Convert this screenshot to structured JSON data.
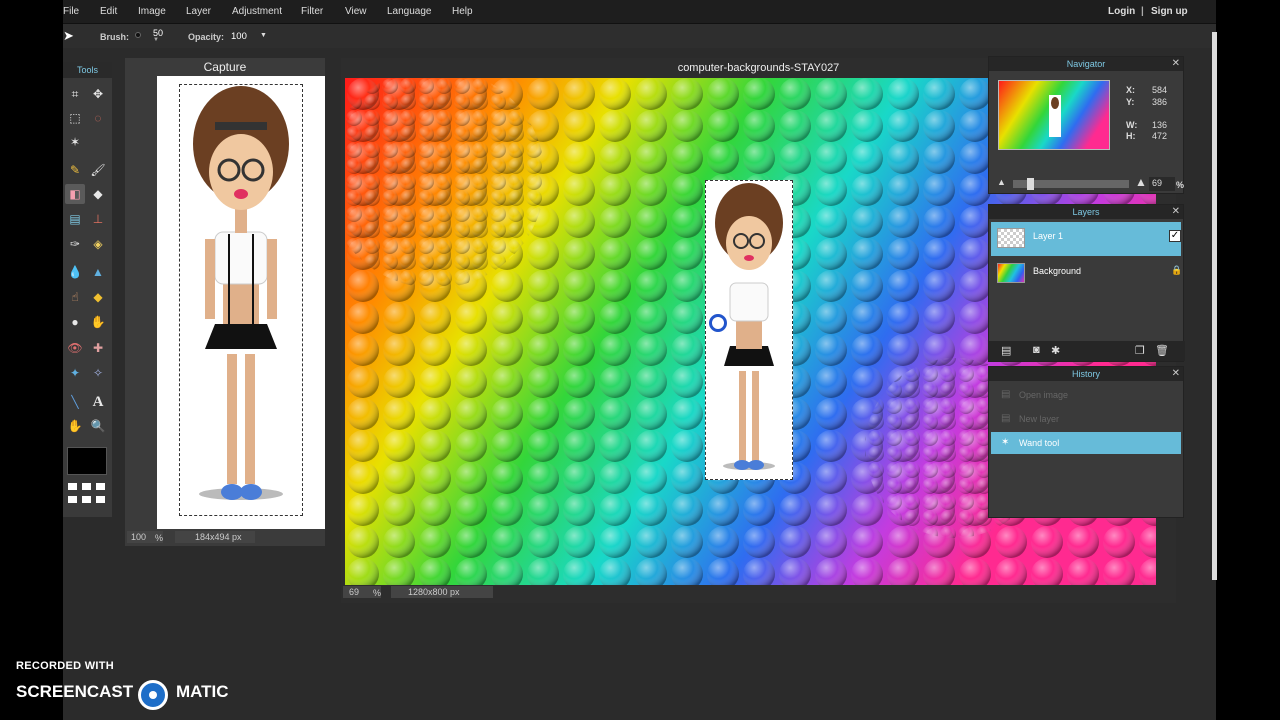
{
  "menu": {
    "items": [
      "File",
      "Edit",
      "Image",
      "Layer",
      "Adjustment",
      "Filter",
      "View",
      "Language",
      "Help"
    ],
    "login": "Login",
    "separator": "|",
    "signup": "Sign up"
  },
  "options": {
    "brush_label": "Brush:",
    "brush_size": "50",
    "opacity_label": "Opacity:",
    "opacity_value": "100"
  },
  "tools": {
    "title": "Tools",
    "foreground_color": "#000000"
  },
  "capture": {
    "title": "Capture",
    "zoom": "100",
    "zoom_unit": "%",
    "dimensions": "184x494 px"
  },
  "document": {
    "title": "computer-backgrounds-STAY027",
    "zoom": "69",
    "zoom_unit": "%",
    "dimensions": "1280x800 px"
  },
  "navigator": {
    "title": "Navigator",
    "x_label": "X:",
    "x_value": "584",
    "y_label": "Y:",
    "y_value": "386",
    "w_label": "W:",
    "w_value": "136",
    "h_label": "H:",
    "h_value": "472",
    "zoom_value": "69",
    "zoom_unit": "%"
  },
  "layers": {
    "title": "Layers",
    "items": [
      {
        "label": "Layer 1"
      },
      {
        "label": "Background"
      }
    ]
  },
  "history": {
    "title": "History",
    "items": [
      {
        "label": "Open image"
      },
      {
        "label": "New layer"
      },
      {
        "label": "Wand tool"
      }
    ]
  },
  "watermark": {
    "line1": "RECORDED WITH",
    "word1": "SCREENCAST",
    "word2": "MATIC"
  },
  "colors": {
    "accent": "#66bbd9",
    "panel_title": "#7ec8e3",
    "app_bg": "#2b2b2b"
  }
}
